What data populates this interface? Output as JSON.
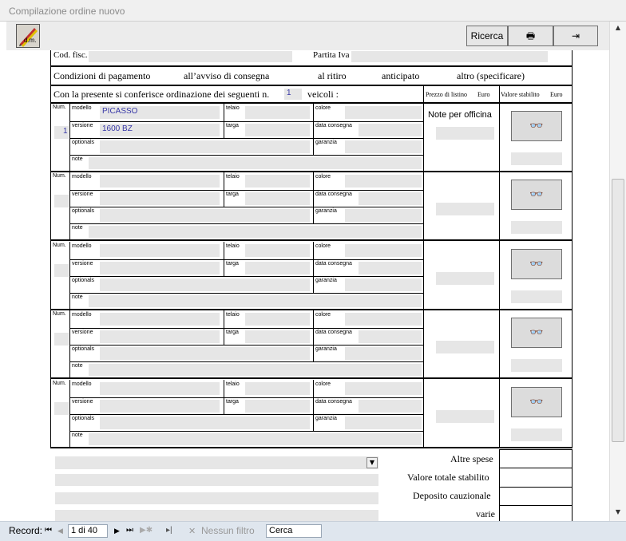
{
  "window": {
    "title": "Compilazione ordine nuovo"
  },
  "toolbar": {
    "search_label": "Ricerca",
    "print_icon": "🖶",
    "exit_icon": "⇥",
    "logo_text": "d.m."
  },
  "customer": {
    "cod_fisc_label": "Cod. fisc.",
    "partita_iva_label": "Partita Iva"
  },
  "payment": {
    "label": "Condizioni di pagamento",
    "options": [
      "all’avviso di consegna",
      "al ritiro",
      "anticipato",
      "altro (specificare)"
    ]
  },
  "order": {
    "intro": "Con la presente si conferisce ordinazione dei seguenti n.",
    "count": "1",
    "suffix": "veicoli :",
    "col_price": "Prezzo di listino",
    "col_price_unit": "Euro",
    "col_value": "Valore stabilito",
    "col_value_unit": "Euro",
    "notes_label": "Note per officina"
  },
  "vehicle_labels": {
    "num": "Num.",
    "modello": "modello",
    "telaio": "telaio",
    "colore": "colore",
    "versione": "versione",
    "targa": "targa",
    "data_consegna": "data consegna",
    "optionals": "optionals",
    "garanzia": "garanzia",
    "note": "note"
  },
  "vehicles": [
    {
      "num": "1",
      "modello": "PICASSO",
      "versione": "1600 BZ"
    },
    {
      "num": "",
      "modello": "",
      "versione": ""
    },
    {
      "num": "",
      "modello": "",
      "versione": ""
    },
    {
      "num": "",
      "modello": "",
      "versione": ""
    },
    {
      "num": "",
      "modello": "",
      "versione": ""
    }
  ],
  "totals": {
    "altre_spese": "Altre spese",
    "valore_totale": "Valore totale stabilito",
    "deposito": "Deposito cauzionale",
    "varie": "varie"
  },
  "glasses_icon": "👓",
  "statusbar": {
    "record_label": "Record:",
    "position": "1 di 40",
    "filter_label": "Nessun filtro",
    "search_value": "Cerca"
  }
}
